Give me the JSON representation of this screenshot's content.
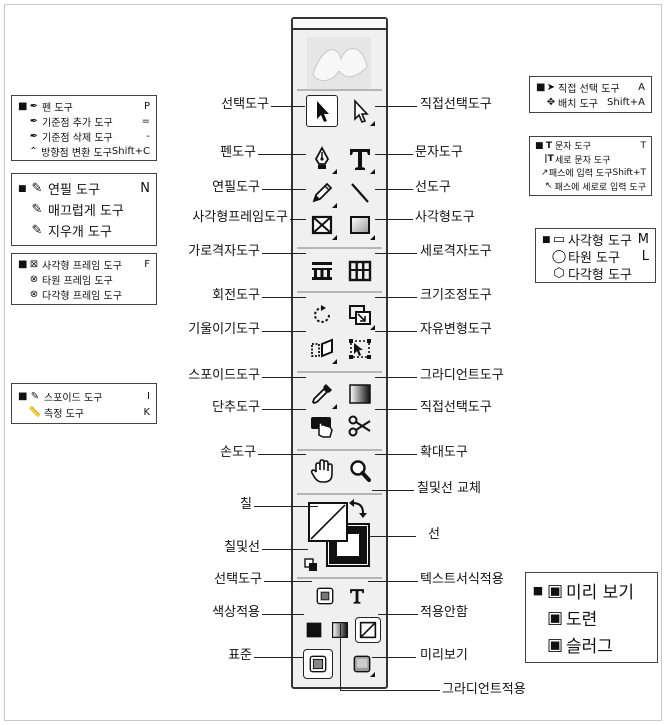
{
  "tools": {
    "selection": "선택도구",
    "direct_selection": "직접선택도구",
    "pen": "펜도구",
    "type": "문자도구",
    "pencil": "연필도구",
    "line": "선도구",
    "rect_frame": "사각형프레임도구",
    "rectangle": "사각형도구",
    "horizontal_grid": "가로격자도구",
    "vertical_grid": "세로격자도구",
    "rotate": "회전도구",
    "scale": "크기조정도구",
    "shear": "기울이기도구",
    "free_transform": "자유변형도구",
    "eyedropper": "스포이드도구",
    "gradient": "그라디언트도구",
    "button": "단추도구",
    "scissors": "직접선택도구",
    "hand": "손도구",
    "zoom": "확대도구",
    "fill": "칠",
    "swap": "칠및선 교체",
    "default_fill_stroke": "칠및선",
    "stroke": "선",
    "formatting_container": "선택도구",
    "formatting_text": "텍스트서식적용",
    "apply_color": "색상적용",
    "apply_none": "적용안함",
    "normal_view": "표준",
    "preview_view": "미리보기",
    "apply_gradient": "그라디언트적용"
  },
  "popups": {
    "pen": [
      {
        "label": "펜 도구",
        "key": "P",
        "bullet": "■"
      },
      {
        "label": "기준점 추가 도구",
        "key": "=",
        "bullet": ""
      },
      {
        "label": "기준점 삭제 도구",
        "key": "-",
        "bullet": ""
      },
      {
        "label": "방향점 변환 도구",
        "key": "Shift+C",
        "bullet": ""
      }
    ],
    "pencil": [
      {
        "label": "연필 도구",
        "key": "N",
        "bullet": "■"
      },
      {
        "label": "매끄럽게 도구",
        "key": "",
        "bullet": ""
      },
      {
        "label": "지우개 도구",
        "key": "",
        "bullet": ""
      }
    ],
    "frame": [
      {
        "label": "사각형 프레임 도구",
        "key": "F",
        "bullet": "■"
      },
      {
        "label": "타원 프레임 도구",
        "key": "",
        "bullet": ""
      },
      {
        "label": "다각형 프레임 도구",
        "key": "",
        "bullet": ""
      }
    ],
    "eyedropper": [
      {
        "label": "스포이드 도구",
        "key": "I",
        "bullet": "■"
      },
      {
        "label": "측정 도구",
        "key": "K",
        "bullet": ""
      }
    ],
    "select": [
      {
        "label": "직접 선택 도구",
        "key": "A",
        "bullet": "■"
      },
      {
        "label": "배치 도구",
        "key": "Shift+A",
        "bullet": ""
      }
    ],
    "type": [
      {
        "label": "문자 도구",
        "key": "T",
        "bullet": "■"
      },
      {
        "label": "세로 문자 도구",
        "key": "",
        "bullet": ""
      },
      {
        "label": "패스에 입력 도구",
        "key": "Shift+T",
        "bullet": ""
      },
      {
        "label": "패스에 세로로 입력 도구",
        "key": "",
        "bullet": ""
      }
    ],
    "shape": [
      {
        "label": "사각형 도구",
        "key": "M",
        "bullet": "■"
      },
      {
        "label": "타원 도구",
        "key": "L",
        "bullet": ""
      },
      {
        "label": "다각형 도구",
        "key": "",
        "bullet": ""
      }
    ],
    "view": [
      {
        "label": "미리 보기",
        "key": "",
        "bullet": "■"
      },
      {
        "label": "도련",
        "key": "",
        "bullet": ""
      },
      {
        "label": "슬러그",
        "key": "",
        "bullet": ""
      }
    ]
  }
}
